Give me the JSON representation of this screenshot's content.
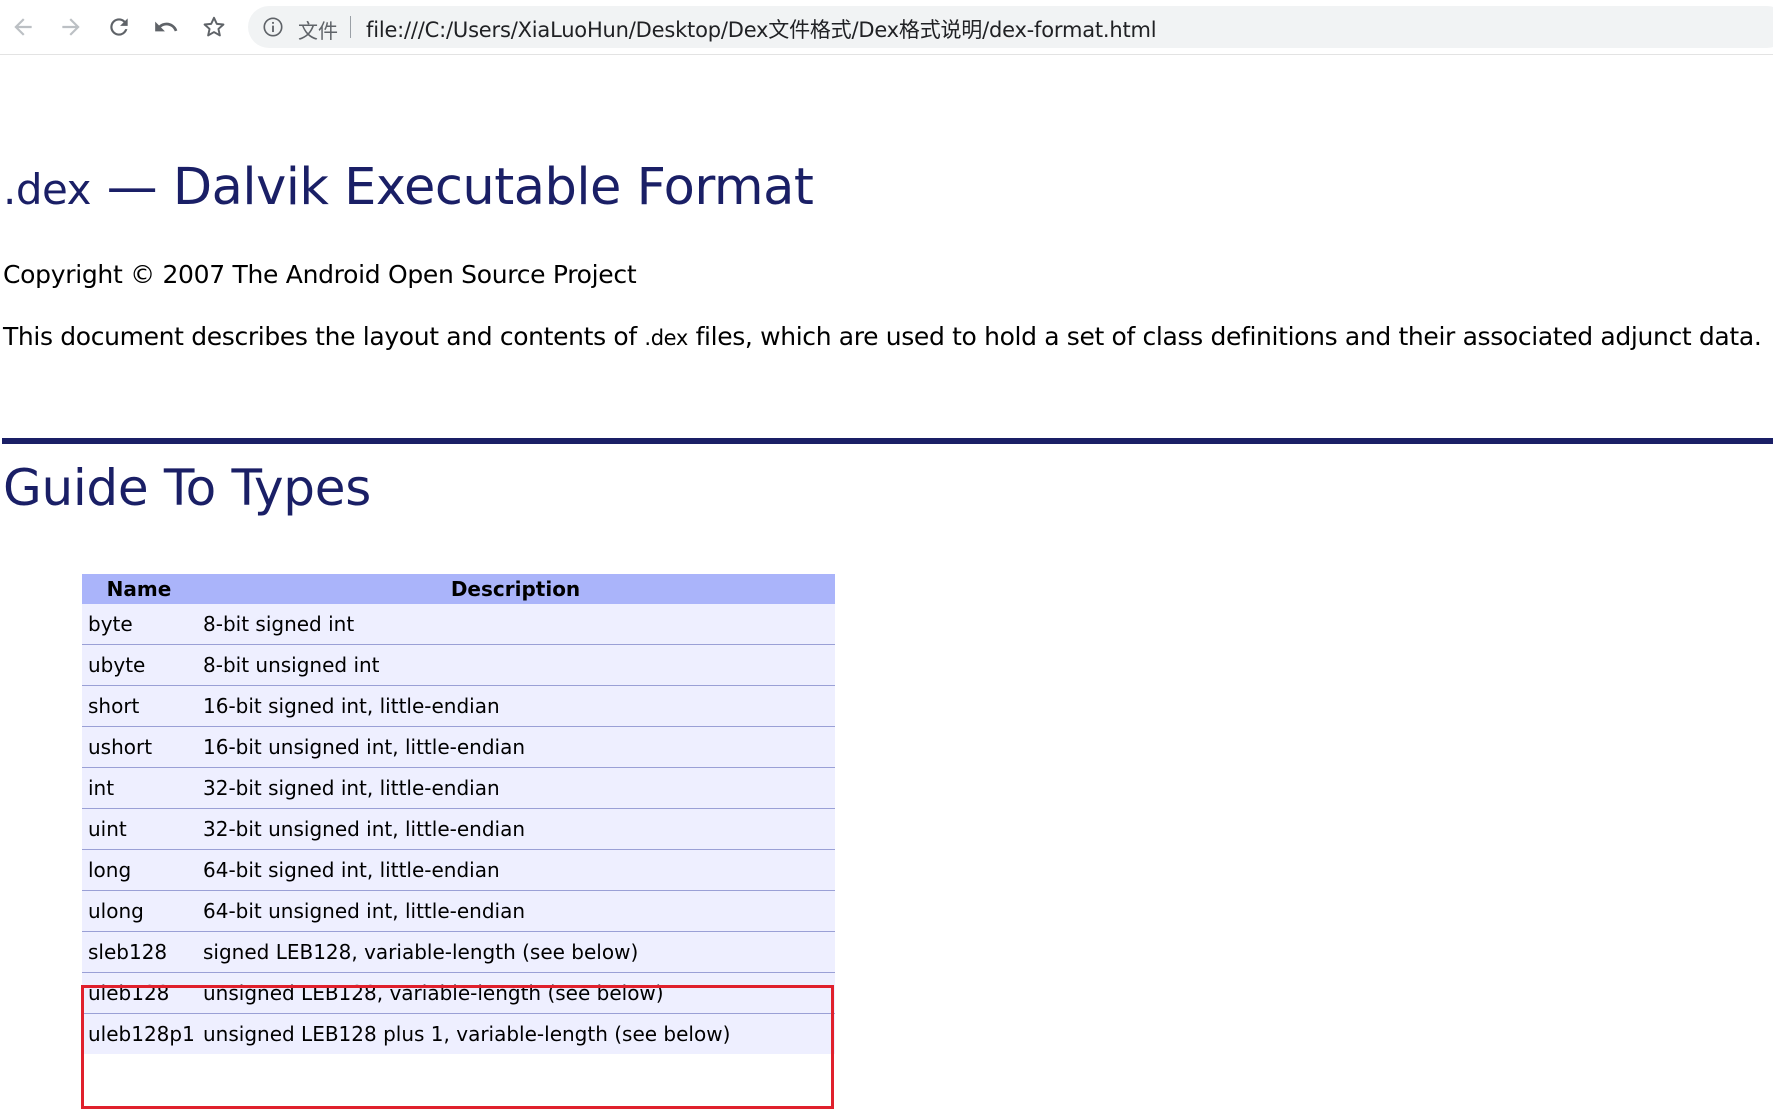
{
  "browser": {
    "back_icon": "arrow-left-icon",
    "forward_icon": "arrow-right-icon",
    "reload_icon": "reload-icon",
    "undo_icon": "undo-icon",
    "bookmark_icon": "star-icon",
    "site_info_icon": "info-icon",
    "scheme_label": "文件",
    "url": "file:///C:/Users/XiaLuoHun/Desktop/Dex文件格式/Dex格式说明/dex-format.html"
  },
  "doc": {
    "title_code": ".dex",
    "title_rest": " — Dalvik Executable Format",
    "copyright": "Copyright © 2007 The Android Open Source Project",
    "intro_before": "This document describes the layout and contents of ",
    "intro_code": ".dex",
    "intro_after": " files, which are used to hold a set of class definitions and their associated adjunct data.",
    "section_title": "Guide To Types",
    "table": {
      "headers": [
        "Name",
        "Description"
      ],
      "rows": [
        {
          "name": "byte",
          "description": "8-bit signed int"
        },
        {
          "name": "ubyte",
          "description": "8-bit unsigned int"
        },
        {
          "name": "short",
          "description": "16-bit signed int, little-endian"
        },
        {
          "name": "ushort",
          "description": "16-bit unsigned int, little-endian"
        },
        {
          "name": "int",
          "description": "32-bit signed int, little-endian"
        },
        {
          "name": "uint",
          "description": "32-bit unsigned int, little-endian"
        },
        {
          "name": "long",
          "description": "64-bit signed int, little-endian"
        },
        {
          "name": "ulong",
          "description": "64-bit unsigned int, little-endian"
        },
        {
          "name": "sleb128",
          "description": "signed LEB128, variable-length (see below)"
        },
        {
          "name": "uleb128",
          "description": "unsigned LEB128, variable-length (see below)"
        },
        {
          "name": "uleb128p1",
          "description": "unsigned LEB128 plus 1, variable-length (see below)"
        }
      ]
    }
  },
  "colors": {
    "heading": "#1a1f66",
    "table_header_bg": "#aab4fa",
    "table_row_bg": "#eeefff",
    "highlight_border": "#e0202c"
  }
}
